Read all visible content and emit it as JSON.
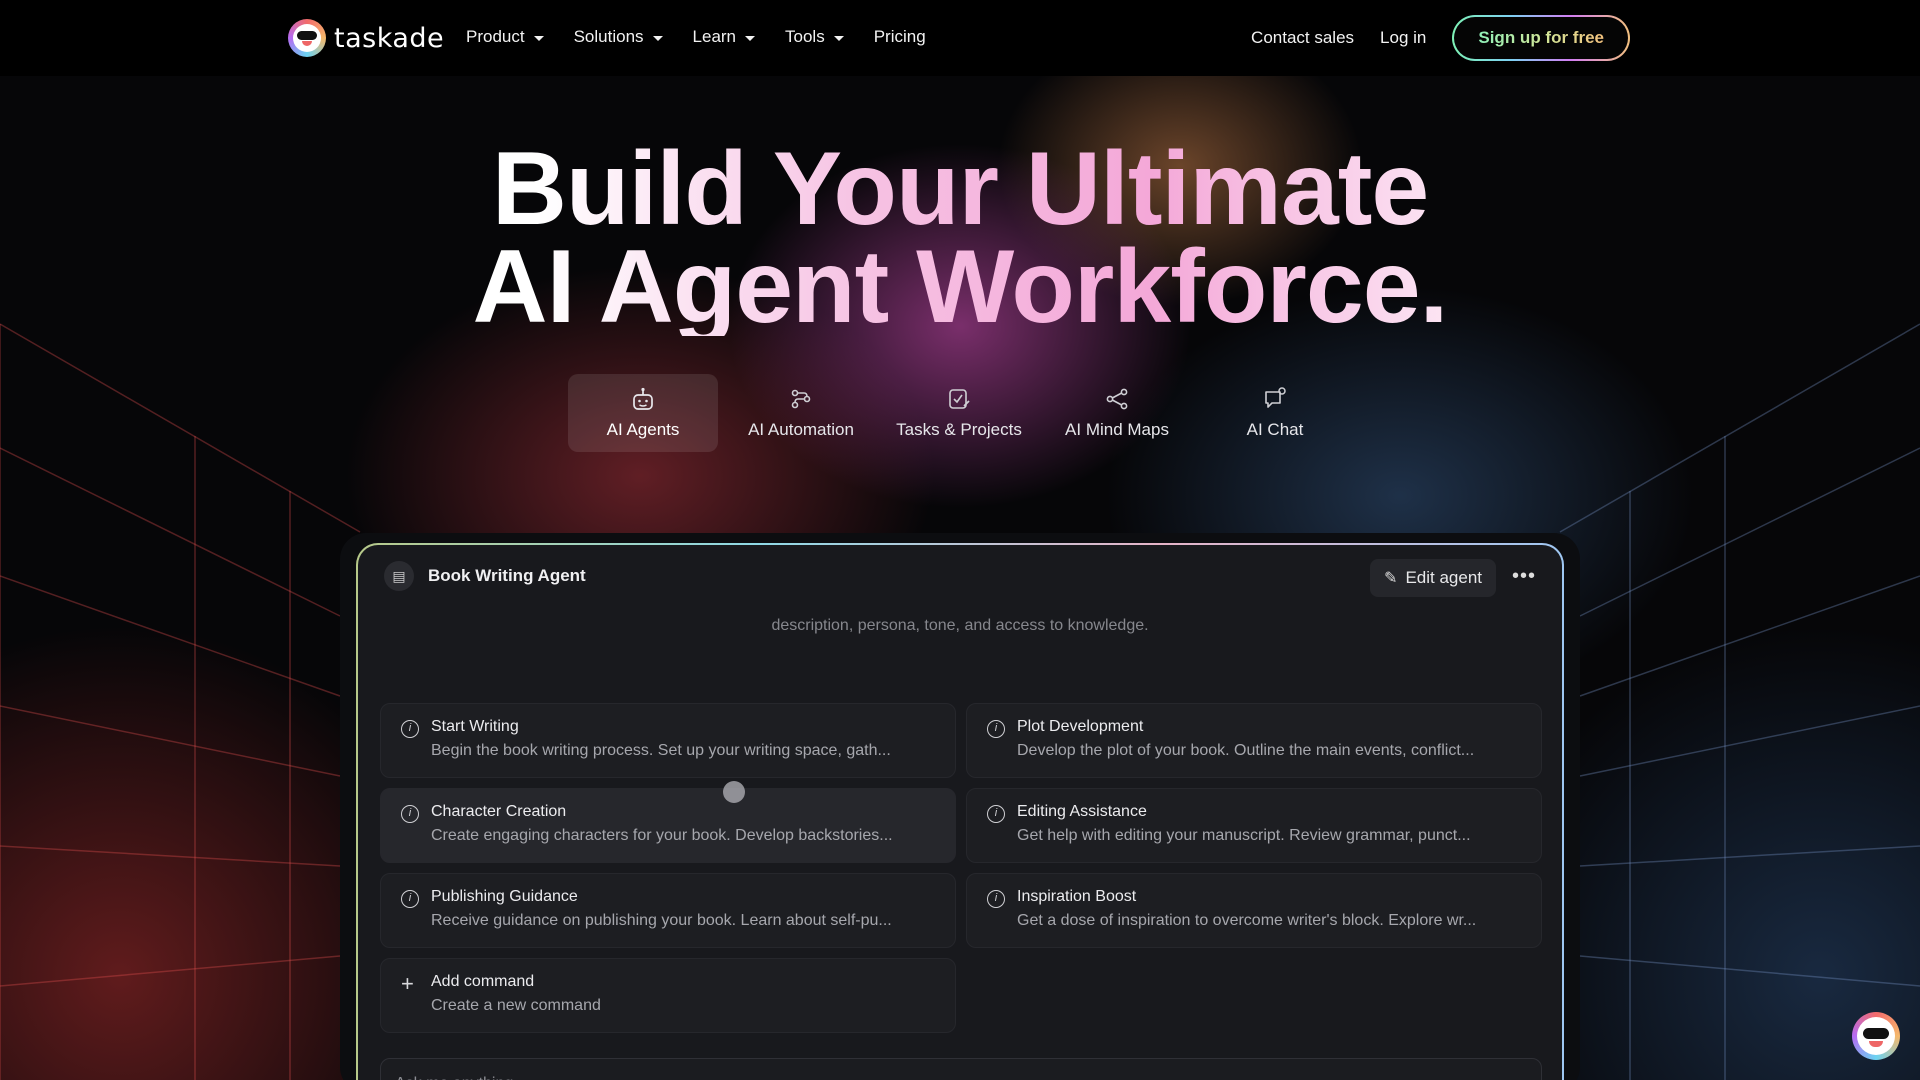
{
  "nav": {
    "logo_text": "taskade",
    "menu": [
      {
        "label": "Product",
        "has_caret": true
      },
      {
        "label": "Solutions",
        "has_caret": true
      },
      {
        "label": "Learn",
        "has_caret": true
      },
      {
        "label": "Tools",
        "has_caret": true
      },
      {
        "label": "Pricing",
        "has_caret": false
      }
    ],
    "contact_sales": "Contact sales",
    "login": "Log in",
    "signup": "Sign up for free"
  },
  "hero": {
    "line1": "Build Your Ultimate",
    "line2": "AI Agent Workforce."
  },
  "tabs": [
    {
      "label": "AI Agents",
      "icon": "robot-icon",
      "active": true
    },
    {
      "label": "AI Automation",
      "icon": "automation-icon",
      "active": false
    },
    {
      "label": "Tasks & Projects",
      "icon": "task-edit-icon",
      "active": false
    },
    {
      "label": "AI Mind Maps",
      "icon": "mind-map-icon",
      "active": false
    },
    {
      "label": "AI Chat",
      "icon": "chat-icon",
      "active": false
    }
  ],
  "agent": {
    "title": "Book Writing Agent",
    "edit_label": "Edit agent",
    "more_label": "•••",
    "description": "description, persona, tone, and access to knowledge.",
    "commands": [
      {
        "title": "Start Writing",
        "desc": "Begin the book writing process. Set up your writing space, gath..."
      },
      {
        "title": "Plot Development",
        "desc": "Develop the plot of your book. Outline the main events, conflict..."
      },
      {
        "title": "Character Creation",
        "desc": "Create engaging characters for your book. Develop backstories..."
      },
      {
        "title": "Editing Assistance",
        "desc": "Get help with editing your manuscript. Review grammar, punct..."
      },
      {
        "title": "Publishing Guidance",
        "desc": "Receive guidance on publishing your book. Learn about self-pu..."
      },
      {
        "title": "Inspiration Boost",
        "desc": "Get a dose of inspiration to overcome writer's block. Explore wr..."
      }
    ],
    "add_command": {
      "title": "Add command",
      "desc": "Create a new command"
    },
    "ask_placeholder": "Ask me anything..."
  },
  "colors": {
    "background": "#000000",
    "accent_pink": "#f4a8d8",
    "signup_text": "#8ff0b8"
  }
}
